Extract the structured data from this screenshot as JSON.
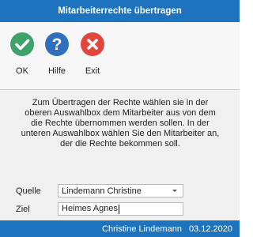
{
  "window": {
    "title": "Mitarbeiterrechte übertragen"
  },
  "toolbar": {
    "ok_label": "OK",
    "help_label": "Hilfe",
    "exit_label": "Exit"
  },
  "content": {
    "description": "Zum Übertragen der Rechte wählen sie in der oberen Auswahlbox dem Mitarbeiter aus von dem die Rechte übernommen werden sollen.  In der unteren Auswahlbox wählen Sie den Mitarbeiter an, der die Rechte bekommen soll.",
    "source": {
      "label": "Quelle",
      "value": "Lindemann Christine"
    },
    "target": {
      "label": "Ziel",
      "value": "Heimes Agnes"
    }
  },
  "status": {
    "user": "Christine Lindemann",
    "date": "03.12.2020"
  },
  "colors": {
    "accent": "#1e73be",
    "ok_icon": "#3ea36a",
    "help_icon": "#2f6fbe",
    "exit_icon": "#e2453c"
  }
}
